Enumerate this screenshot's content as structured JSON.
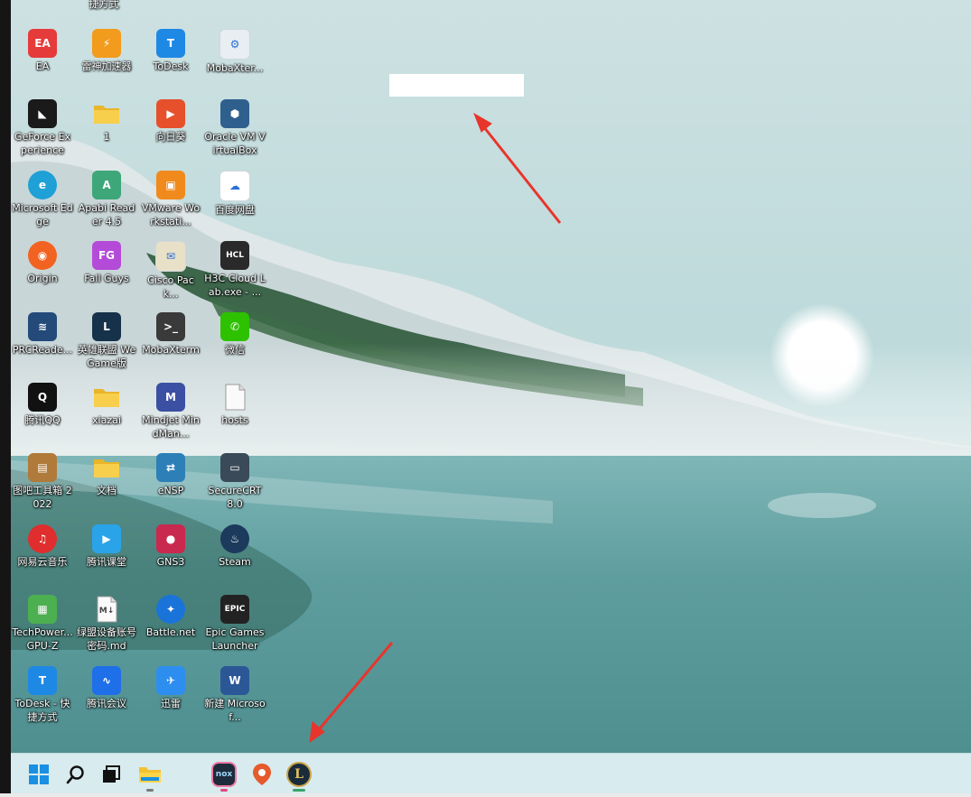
{
  "desktop": {
    "top_partial": [
      {
        "label": "捷方式"
      }
    ],
    "icons": [
      {
        "id": "ea",
        "label": "EA",
        "name": "ea-icon",
        "color": "#e53b3b",
        "glyph": "EA"
      },
      {
        "id": "leishen",
        "label": "雷神加速器",
        "name": "leishen-accelerator-icon",
        "color": "#f29b1d",
        "glyph": "⚡"
      },
      {
        "id": "todesk",
        "label": "ToDesk",
        "name": "todesk-icon",
        "color": "#1e88e5",
        "glyph": "T"
      },
      {
        "id": "mobaxterm1",
        "label": "MobaXter...",
        "name": "mobaxterm-shortcut-icon",
        "color": "#e9eef2",
        "glyph": "⚙"
      },
      {
        "id": "geforce",
        "label": "GeForce Experience",
        "name": "geforce-experience-icon",
        "color": "#1a1a1a",
        "glyph": "◣"
      },
      {
        "id": "folder1",
        "label": "1",
        "name": "folder-icon",
        "color": "#f5c542",
        "glyph": ""
      },
      {
        "id": "xiangrikui",
        "label": "向日葵",
        "name": "sunlogin-icon",
        "color": "#e6502b",
        "glyph": "▶"
      },
      {
        "id": "virtualbox",
        "label": "Oracle VM VirtualBox",
        "name": "virtualbox-icon",
        "color": "#2f5f8d",
        "glyph": "⬢"
      },
      {
        "id": "edge",
        "label": "Microsoft Edge",
        "name": "edge-icon",
        "color": "#1fa0d6",
        "glyph": "e"
      },
      {
        "id": "apabi",
        "label": "Apabi Reader 4.5",
        "name": "apabi-reader-icon",
        "color": "#3da77a",
        "glyph": "A"
      },
      {
        "id": "vmware",
        "label": "VMware Workstati...",
        "name": "vmware-icon",
        "color": "#f08a1d",
        "glyph": "▣"
      },
      {
        "id": "baidupan",
        "label": "百度网盘",
        "name": "baidu-netdisk-icon",
        "color": "#ffffff",
        "glyph": "☁"
      },
      {
        "id": "origin",
        "label": "Origin",
        "name": "origin-icon",
        "color": "#f26322",
        "glyph": "◉"
      },
      {
        "id": "fallguys",
        "label": "Fall Guys",
        "name": "fall-guys-icon",
        "color": "#b44bd8",
        "glyph": "FG"
      },
      {
        "id": "cisco",
        "label": "Cisco Pack...",
        "name": "cisco-packet-tracer-icon",
        "color": "#e8e1c8",
        "glyph": "✉"
      },
      {
        "id": "h3c",
        "label": "H3C Cloud Lab.exe - ...",
        "name": "h3c-cloud-lab-icon",
        "color": "#2a2a2a",
        "glyph": "HCL"
      },
      {
        "id": "prcreader",
        "label": "PRCReade...",
        "name": "prc-reader-icon",
        "color": "#244a7a",
        "glyph": "≋"
      },
      {
        "id": "lol",
        "label": "英雄联盟 WeGame版",
        "name": "league-of-legends-icon",
        "color": "#16324a",
        "glyph": "L"
      },
      {
        "id": "mobaxterm2",
        "label": "MobaXterm",
        "name": "mobaxterm-icon",
        "color": "#3a3a3a",
        "glyph": ">_"
      },
      {
        "id": "wechat",
        "label": "微信",
        "name": "wechat-icon",
        "color": "#2dc100",
        "glyph": "✆"
      },
      {
        "id": "qq",
        "label": "腾讯QQ",
        "name": "qq-icon",
        "color": "#111111",
        "glyph": "Q"
      },
      {
        "id": "xiazai",
        "label": "xiazai",
        "name": "folder-icon",
        "color": "#f5c542",
        "glyph": ""
      },
      {
        "id": "mindjet",
        "label": "Mindjet MindMan...",
        "name": "mindmanager-icon",
        "color": "#3b4fa3",
        "glyph": "M"
      },
      {
        "id": "hosts",
        "label": "hosts",
        "name": "file-icon",
        "color": "#f4f4f4",
        "glyph": ""
      },
      {
        "id": "tubaxiang",
        "label": "图吧工具箱 2022",
        "name": "tuba-toolbox-icon",
        "color": "#b07a3a",
        "glyph": "▤"
      },
      {
        "id": "wendang",
        "label": "文档",
        "name": "folder-icon",
        "color": "#f5c542",
        "glyph": ""
      },
      {
        "id": "ensp",
        "label": "eNSP",
        "name": "ensp-icon",
        "color": "#2d7fb8",
        "glyph": "⇄"
      },
      {
        "id": "securecrt",
        "label": "SecureCRT 8.0",
        "name": "securecrt-icon",
        "color": "#3a4a58",
        "glyph": "▭"
      },
      {
        "id": "netease",
        "label": "网易云音乐",
        "name": "netease-music-icon",
        "color": "#e02d2d",
        "glyph": "♫"
      },
      {
        "id": "txketang",
        "label": "腾讯课堂",
        "name": "tencent-classroom-icon",
        "color": "#2aa3e8",
        "glyph": "▶"
      },
      {
        "id": "gns3",
        "label": "GNS3",
        "name": "gns3-icon",
        "color": "#c9294e",
        "glyph": "●"
      },
      {
        "id": "steam",
        "label": "Steam",
        "name": "steam-icon",
        "color": "#1b3a5c",
        "glyph": "♨"
      },
      {
        "id": "gpuz",
        "label": "TechPower... GPU-Z",
        "name": "gpu-z-icon",
        "color": "#4caf50",
        "glyph": "▦"
      },
      {
        "id": "lvmeng",
        "label": "绿盟设备账号 密码.md",
        "name": "markdown-file-icon",
        "color": "#f4f4f4",
        "glyph": "M↓"
      },
      {
        "id": "battlenet",
        "label": "Battle.net",
        "name": "battlenet-icon",
        "color": "#1a73d9",
        "glyph": "✦"
      },
      {
        "id": "epic",
        "label": "Epic Games Launcher",
        "name": "epic-games-icon",
        "color": "#222222",
        "glyph": "EPIC"
      },
      {
        "id": "todesk2",
        "label": "ToDesk - 快 捷方式",
        "name": "todesk-shortcut-icon",
        "color": "#1e88e5",
        "glyph": "T"
      },
      {
        "id": "txmeeting",
        "label": "腾讯会议",
        "name": "tencent-meeting-icon",
        "color": "#1e6fe8",
        "glyph": "∿"
      },
      {
        "id": "xunlei",
        "label": "迅雷",
        "name": "thunder-icon",
        "color": "#2d8ef0",
        "glyph": "✈"
      },
      {
        "id": "word",
        "label": "新建 Microsof...",
        "name": "word-document-icon",
        "color": "#2b5797",
        "glyph": "W"
      }
    ]
  },
  "taskbar": {
    "items": [
      {
        "id": "start",
        "name": "start-icon"
      },
      {
        "id": "search",
        "name": "search-icon"
      },
      {
        "id": "taskview",
        "name": "task-view-icon"
      },
      {
        "id": "explorer",
        "name": "file-explorer-icon"
      },
      {
        "id": "nox",
        "name": "nox-player-icon",
        "glyph": "nox"
      },
      {
        "id": "maps",
        "name": "location-pin-icon"
      },
      {
        "id": "lol",
        "name": "league-of-legends-taskbar-icon",
        "glyph": "L"
      }
    ]
  },
  "colors": {
    "taskbar_bg": "#d8ebee",
    "arrow": "#e8352b",
    "start_blue": "#1a8fe3"
  }
}
